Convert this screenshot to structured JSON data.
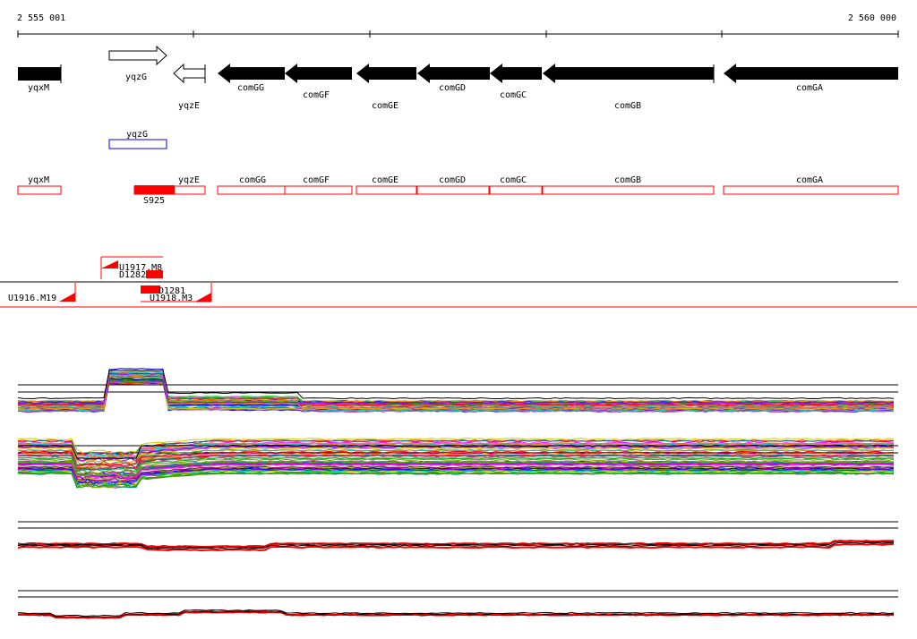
{
  "coords": {
    "start": "2 555 001",
    "end": "2 560 000"
  },
  "colors": {
    "gene_fill": "#000000",
    "feature_outline": "#ff0000",
    "feature_fill": "#ff0000",
    "alt_outline": "#0000ff"
  },
  "genes": [
    {
      "name": "yqxM",
      "strand": "+",
      "filled": true
    },
    {
      "name": "yqzG",
      "strand": "+",
      "filled": false
    },
    {
      "name": "yqzE",
      "strand": "-",
      "filled": false
    },
    {
      "name": "comGG",
      "strand": "-",
      "filled": true
    },
    {
      "name": "comGF",
      "strand": "-",
      "filled": true
    },
    {
      "name": "comGE",
      "strand": "-",
      "filled": true
    },
    {
      "name": "comGD",
      "strand": "-",
      "filled": true
    },
    {
      "name": "comGC",
      "strand": "-",
      "filled": true
    },
    {
      "name": "comGB",
      "strand": "-",
      "filled": true
    },
    {
      "name": "comGA",
      "strand": "-",
      "filled": true
    }
  ],
  "alt_feature": {
    "name": "yqzG"
  },
  "features": [
    "yqxM",
    "yqzE",
    "comGG",
    "comGF",
    "comGE",
    "comGD",
    "comGC",
    "comGB",
    "comGA"
  ],
  "site": {
    "name": "S925"
  },
  "probes": [
    "U1917.M8",
    "D1282",
    "D1281",
    "U1916.M19",
    "U1918.M3"
  ]
}
